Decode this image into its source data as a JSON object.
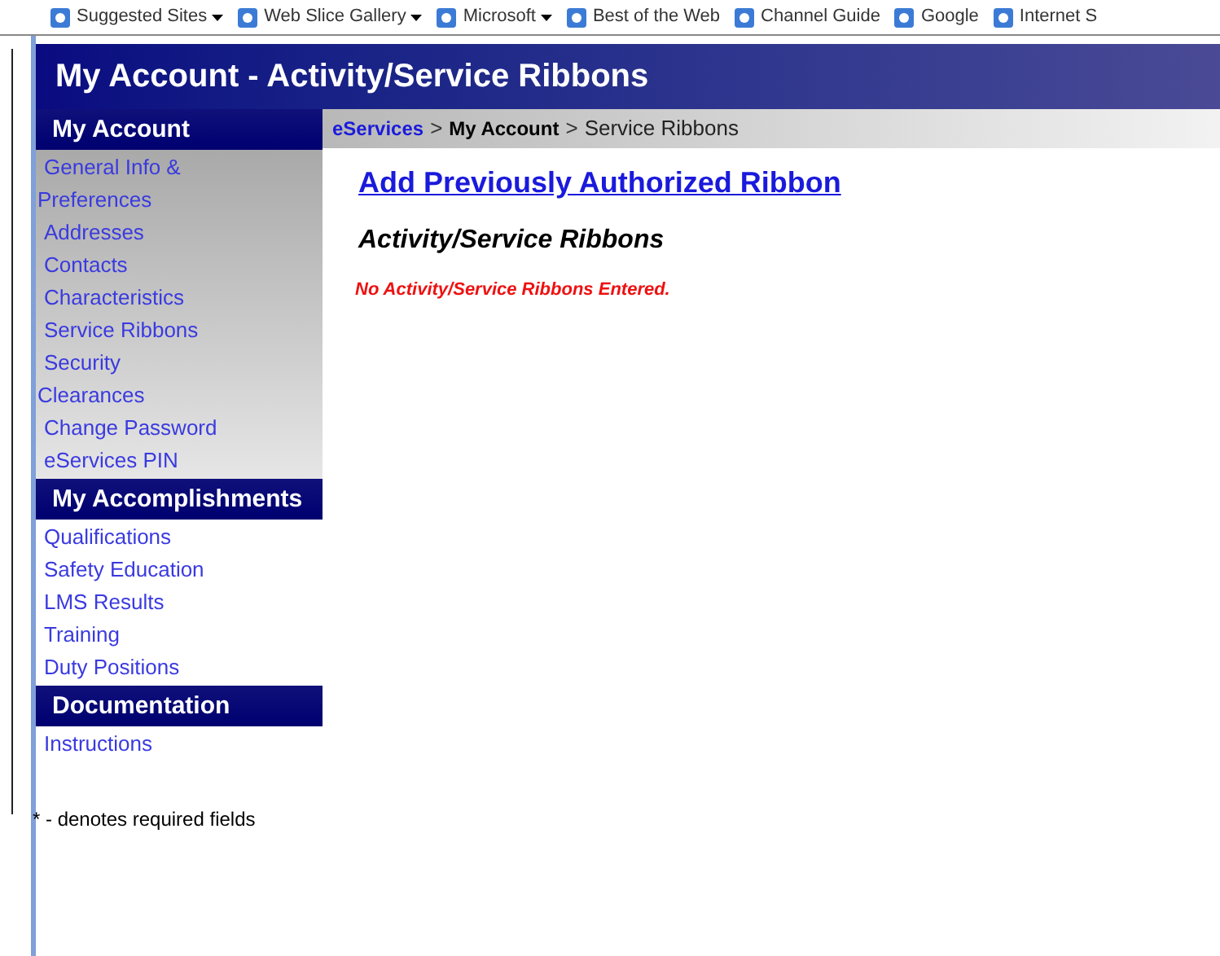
{
  "favorites_bar": [
    {
      "label": "Suggested Sites",
      "kind": "menu"
    },
    {
      "label": "Web Slice Gallery",
      "kind": "menu"
    },
    {
      "label": "Microsoft",
      "kind": "menu"
    },
    {
      "label": "Best of the Web",
      "kind": "link"
    },
    {
      "label": "Channel Guide",
      "kind": "link"
    },
    {
      "label": "Google",
      "kind": "link"
    },
    {
      "label": "Internet S",
      "kind": "link"
    }
  ],
  "page_title": "My Account - Activity/Service Ribbons",
  "sidebar": [
    {
      "heading": "My Account",
      "shaded": true,
      "items": [
        "General Info & Preferences",
        "Addresses",
        "Contacts",
        "Characteristics",
        "Service Ribbons",
        "Security Clearances",
        "Change Password",
        "eServices PIN"
      ]
    },
    {
      "heading": "My Accomplishments",
      "shaded": false,
      "items": [
        "Qualifications",
        "Safety Education",
        "LMS Results",
        "Training",
        "Duty Positions"
      ]
    },
    {
      "heading": "Documentation",
      "shaded": false,
      "items": [
        "Instructions"
      ]
    }
  ],
  "footnote": "* - denotes required fields",
  "breadcrumb": [
    {
      "label": "eServices",
      "kind": "link"
    },
    {
      "label": ">",
      "kind": "separator"
    },
    {
      "label": "My Account",
      "kind": "bold"
    },
    {
      "label": ">",
      "kind": "separator"
    },
    {
      "label": "Service Ribbons",
      "kind": "plain"
    }
  ],
  "add_link": "Add Previously Authorized Ribbon",
  "section_title": "Activity/Service Ribbons",
  "empty_message": "No Activity/Service Ribbons Entered."
}
